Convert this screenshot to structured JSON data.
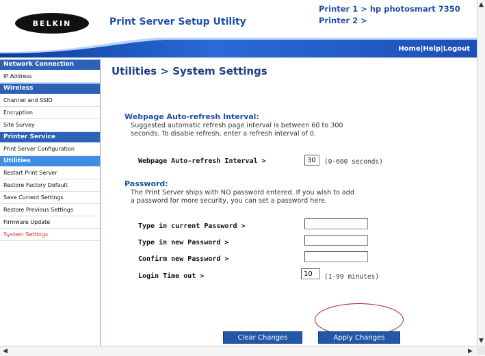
{
  "header": {
    "logo": "BELKIN",
    "app_title": "Print Server Setup Utility",
    "printer1": "Printer 1 > hp photosmart 7350",
    "printer2": "Printer 2 >",
    "links": {
      "home": "Home",
      "sep1": "|",
      "help": "Help",
      "sep2": "|",
      "logout": "Logout"
    }
  },
  "sidebar": {
    "sections": [
      {
        "title": "Network Connection",
        "items": [
          "IP Address"
        ]
      },
      {
        "title": "Wireless",
        "items": [
          "Channel and SSID",
          "Encryption",
          "Site Survey"
        ]
      },
      {
        "title": "Printer Service",
        "items": [
          "Print Server Configuration"
        ]
      },
      {
        "title": "Utilities",
        "items": [
          "Restart Print Server",
          "Restore Factory Default",
          "Save Current Settings",
          "Restore Previous Settings",
          "Firmware Update",
          "System Settings"
        ]
      }
    ],
    "active_item": "System Settings"
  },
  "main": {
    "page_title": "Utilities > System Settings",
    "refresh": {
      "title": "Webpage Auto-refresh Interval:",
      "desc_line1": "Suggested automatic refresh page interval is between 60 to 300",
      "desc_line2": "seconds. To disable refresh, enter a refresh interval of 0.",
      "field_label": "Webpage Auto-refresh Interval >",
      "value": "30",
      "hint": "(0-600 seconds)"
    },
    "password": {
      "title": "Password:",
      "desc_line1": "The Print Server ships with NO password entered. If you wish to add",
      "desc_line2": "a password for more security, you can set a password here.",
      "current_label": "Type in current Password >",
      "current_value": "",
      "new_label": "Type in new Password >",
      "new_value": "",
      "confirm_label": "Confirm new Password >",
      "confirm_value": "",
      "timeout_label": "Login Time out >",
      "timeout_value": "10",
      "timeout_hint": "(1-99 minutes)"
    },
    "buttons": {
      "clear": "Clear Changes",
      "apply": "Apply Changes"
    }
  },
  "colors": {
    "nav_blue": "#2b62b8",
    "title_blue": "#1f4fa8",
    "active_red": "#e0262a",
    "highlight_ellipse": "#b3122b"
  }
}
